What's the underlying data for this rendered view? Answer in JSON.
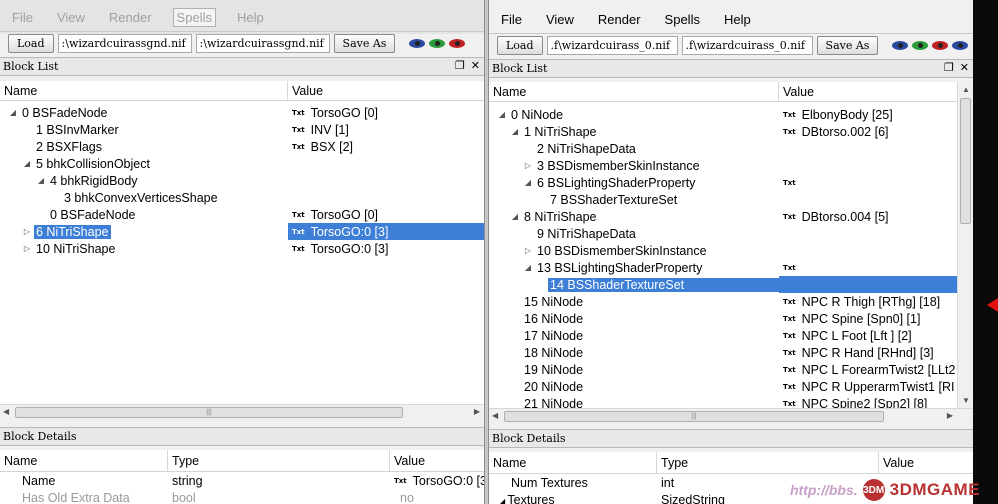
{
  "left": {
    "menu": [
      "File",
      "View",
      "Render",
      "Spells",
      "Help"
    ],
    "toolbar": {
      "load": "Load",
      "path1": ":\\wizardcuirassgnd.nif",
      "path2": ":\\wizardcuirassgnd.nif",
      "save": "Save As"
    },
    "block_list_title": "Block List",
    "cols": {
      "name": "Name",
      "value": "Value"
    },
    "rows": [
      {
        "indent": 0,
        "arrow": "open",
        "label": "0 BSFadeNode",
        "txt": "Txt",
        "value": "TorsoGO [0]"
      },
      {
        "indent": 1,
        "arrow": "",
        "label": "1 BSInvMarker",
        "txt": "Txt",
        "value": "INV [1]"
      },
      {
        "indent": 1,
        "arrow": "",
        "label": "2 BSXFlags",
        "txt": "Txt",
        "value": "BSX [2]"
      },
      {
        "indent": 1,
        "arrow": "open",
        "label": "5 bhkCollisionObject",
        "txt": "",
        "value": ""
      },
      {
        "indent": 2,
        "arrow": "open",
        "label": "4 bhkRigidBody",
        "txt": "",
        "value": ""
      },
      {
        "indent": 3,
        "arrow": "",
        "label": "3 bhkConvexVerticesShape",
        "txt": "",
        "value": ""
      },
      {
        "indent": 2,
        "arrow": "",
        "label": "0 BSFadeNode",
        "txt": "Txt",
        "value": "TorsoGO [0]"
      },
      {
        "indent": 1,
        "arrow": "closed",
        "label": "6 NiTriShape",
        "txt": "Txt",
        "value": "TorsoGO:0 [3]",
        "sel": true
      },
      {
        "indent": 1,
        "arrow": "closed",
        "label": "10 NiTriShape",
        "txt": "Txt",
        "value": "TorsoGO:0 [3]"
      }
    ],
    "block_details_title": "Block Details",
    "dcols": {
      "name": "Name",
      "type": "Type",
      "value": "Value"
    },
    "drows": [
      {
        "name": "Name",
        "type": "string",
        "txt": "Txt",
        "value": "TorsoGO:0 [3]",
        "gray": false
      },
      {
        "name": "Has Old Extra Data",
        "type": "bool",
        "txt": "",
        "value": "no",
        "gray": true
      }
    ]
  },
  "right": {
    "menu": [
      "File",
      "View",
      "Render",
      "Spells",
      "Help"
    ],
    "toolbar": {
      "load": "Load",
      "path1": ".f\\wizardcuirass_0.nif",
      "path2": ".f\\wizardcuirass_0.nif",
      "save": "Save As"
    },
    "block_list_title": "Block List",
    "cols": {
      "name": "Name",
      "value": "Value"
    },
    "rows": [
      {
        "indent": 0,
        "arrow": "open",
        "label": "0 NiNode",
        "txt": "Txt",
        "value": "ElbonyBody [25]"
      },
      {
        "indent": 1,
        "arrow": "open",
        "label": "1 NiTriShape",
        "txt": "Txt",
        "value": "DBtorso.002 [6]"
      },
      {
        "indent": 2,
        "arrow": "",
        "label": "2 NiTriShapeData",
        "txt": "",
        "value": ""
      },
      {
        "indent": 2,
        "arrow": "closed",
        "label": "3 BSDismemberSkinInstance",
        "txt": "",
        "value": ""
      },
      {
        "indent": 2,
        "arrow": "open",
        "label": "6 BSLightingShaderProperty",
        "txt": "Txt",
        "value": ""
      },
      {
        "indent": 3,
        "arrow": "",
        "label": "7 BSShaderTextureSet",
        "txt": "",
        "value": ""
      },
      {
        "indent": 1,
        "arrow": "open",
        "label": "8 NiTriShape",
        "txt": "Txt",
        "value": "DBtorso.004 [5]"
      },
      {
        "indent": 2,
        "arrow": "",
        "label": "9 NiTriShapeData",
        "txt": "",
        "value": ""
      },
      {
        "indent": 2,
        "arrow": "closed",
        "label": "10 BSDismemberSkinInstance",
        "txt": "",
        "value": ""
      },
      {
        "indent": 2,
        "arrow": "open",
        "label": "13 BSLightingShaderProperty",
        "txt": "Txt",
        "value": ""
      },
      {
        "indent": 3,
        "arrow": "",
        "label": "14 BSShaderTextureSet",
        "txt": "",
        "value": "",
        "sel": true
      },
      {
        "indent": 1,
        "arrow": "",
        "label": "15 NiNode",
        "txt": "Txt",
        "value": "NPC R Thigh [RThg] [18]"
      },
      {
        "indent": 1,
        "arrow": "",
        "label": "16 NiNode",
        "txt": "Txt",
        "value": "NPC Spine [Spn0] [1]"
      },
      {
        "indent": 1,
        "arrow": "",
        "label": "17 NiNode",
        "txt": "Txt",
        "value": "NPC L Foot [Lft ] [2]"
      },
      {
        "indent": 1,
        "arrow": "",
        "label": "18 NiNode",
        "txt": "Txt",
        "value": "NPC R Hand [RHnd] [3]"
      },
      {
        "indent": 1,
        "arrow": "",
        "label": "19 NiNode",
        "txt": "Txt",
        "value": "NPC L ForearmTwist2 [LLt2"
      },
      {
        "indent": 1,
        "arrow": "",
        "label": "20 NiNode",
        "txt": "Txt",
        "value": "NPC R UpperarmTwist1 [RI"
      },
      {
        "indent": 1,
        "arrow": "",
        "label": "21 NiNode",
        "txt": "Txt",
        "value": "NPC Spine2 [Spn2] [8]"
      }
    ],
    "block_details_title": "Block Details",
    "dcols": {
      "name": "Name",
      "type": "Type",
      "value": "Value"
    },
    "drows": [
      {
        "name": "Num Textures",
        "type": "int",
        "txt": "",
        "value": "",
        "arrow": ""
      },
      {
        "name": "Textures",
        "type": "SizedString",
        "txt": "",
        "value": "",
        "arrow": "open"
      }
    ]
  },
  "watermark": {
    "url": "http://bbs.",
    "brand": "3DMGAME",
    "logo": "3DM"
  },
  "colors": {
    "selection": "#3d7ed6",
    "eye_blue": "#2a4aa0",
    "eye_green": "#2a9a3a",
    "eye_red": "#c02020"
  }
}
